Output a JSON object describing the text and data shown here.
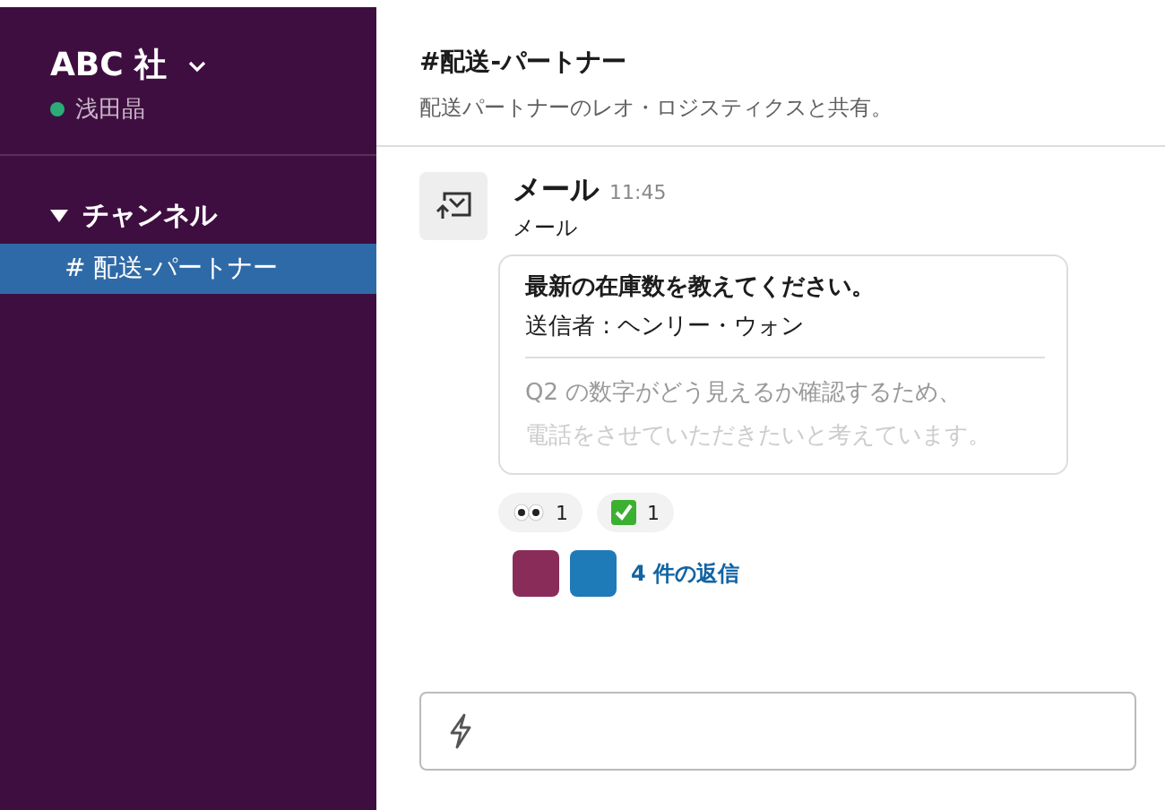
{
  "sidebar": {
    "workspace": "ABC 社",
    "user": {
      "name": "浅田晶",
      "online": true
    },
    "sections": [
      {
        "label": "チャンネル",
        "expanded": true,
        "items": [
          {
            "label": "# 配送-パートナー",
            "selected": true
          }
        ]
      }
    ]
  },
  "channel": {
    "title": "#配送-パートナー",
    "description": "配送パートナーのレオ・ロジスティクスと共有。"
  },
  "messages": [
    {
      "sender": "メール",
      "time": "11:45",
      "subtitle": "メール",
      "email": {
        "subject": "最新の在庫数を教えてください。",
        "from": "送信者 : ヘンリー・ウォン",
        "body": [
          "Q2 の数字がどう見えるか確認するため、",
          "電話をさせていただきたいと考えています。"
        ]
      },
      "reactions": [
        {
          "kind": "eyes",
          "count": "1"
        },
        {
          "kind": "check",
          "count": "1"
        }
      ],
      "replies": {
        "avatars": [
          {
            "color": "#8a2c5a"
          },
          {
            "color": "#1f7ab8"
          }
        ],
        "label": "4 件の返信"
      }
    }
  ]
}
